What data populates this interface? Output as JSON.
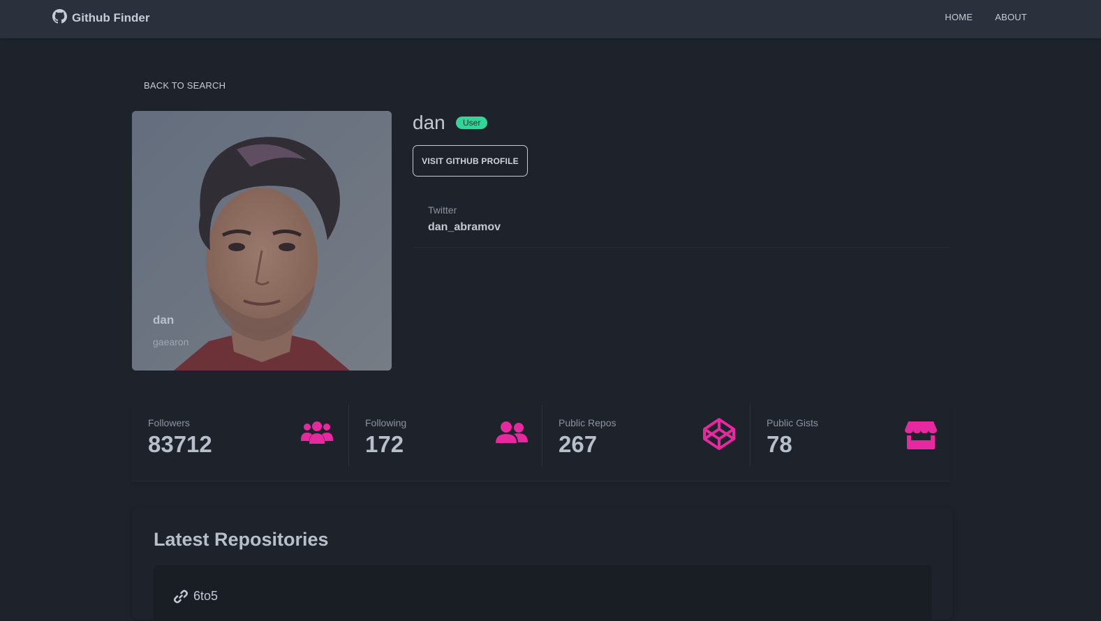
{
  "navbar": {
    "brand": "Github Finder",
    "links": [
      "HOME",
      "ABOUT"
    ]
  },
  "back_link": "BACK TO SEARCH",
  "avatar": {
    "name": "dan",
    "login": "gaearon"
  },
  "profile": {
    "name": "dan",
    "type_badge": "User",
    "visit_button": "VISIT GITHUB PROFILE"
  },
  "social": {
    "label": "Twitter",
    "value": "dan_abramov"
  },
  "stats": [
    {
      "label": "Followers",
      "value": "83712",
      "icon": "users-icon"
    },
    {
      "label": "Following",
      "value": "172",
      "icon": "user-friends-icon"
    },
    {
      "label": "Public Repos",
      "value": "267",
      "icon": "codepen-icon"
    },
    {
      "label": "Public Gists",
      "value": "78",
      "icon": "store-icon"
    }
  ],
  "repos": {
    "title": "Latest Repositories",
    "items": [
      {
        "name": "6to5",
        "icon": "link-icon"
      }
    ]
  },
  "colors": {
    "navbar_bg": "#2a303c",
    "page_bg": "#1e222b",
    "accent": "#e6299f",
    "badge": "#36d399"
  }
}
